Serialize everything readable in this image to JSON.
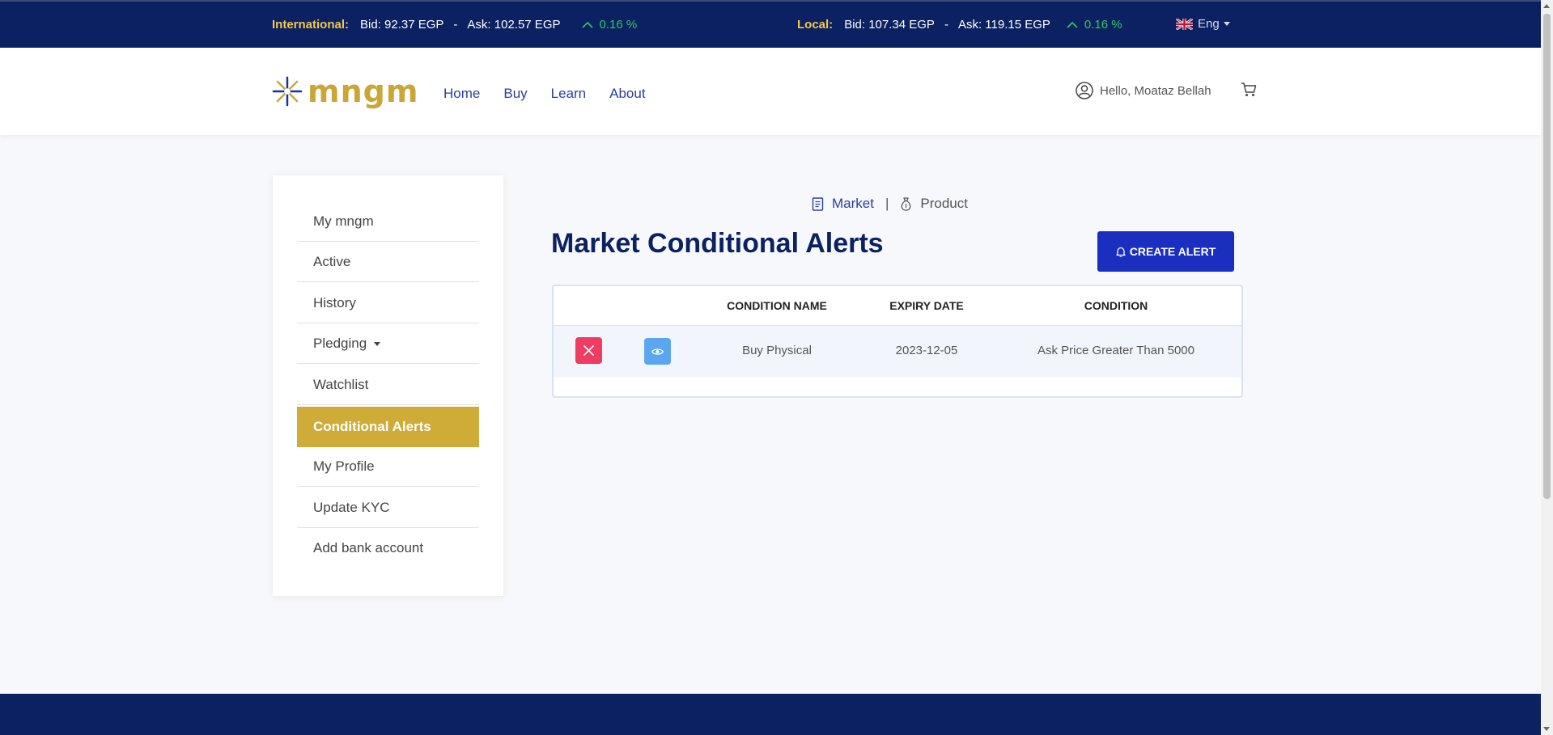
{
  "ticker": {
    "international": {
      "label": "International:",
      "bid": "Bid: 92.37 EGP",
      "sep": "-",
      "ask": "Ask: 102.57 EGP",
      "change": "0.16 %"
    },
    "local": {
      "label": "Local:",
      "bid": "Bid: 107.34 EGP",
      "sep": "-",
      "ask": "Ask: 119.15 EGP",
      "change": "0.16 %"
    },
    "language": "Eng"
  },
  "header": {
    "logo": "mngm",
    "nav": [
      "Home",
      "Buy",
      "Learn",
      "About"
    ],
    "greeting": "Hello, Moataz Bellah"
  },
  "sidebar": {
    "items": [
      {
        "label": "My mngm"
      },
      {
        "label": "Active"
      },
      {
        "label": "History"
      },
      {
        "label": "Pledging"
      },
      {
        "label": "Watchlist"
      },
      {
        "label": "Conditional Alerts"
      },
      {
        "label": "My Profile"
      },
      {
        "label": "Update KYC"
      },
      {
        "label": "Add bank account"
      }
    ],
    "active_index": 5
  },
  "main": {
    "toggle": {
      "market": "Market",
      "separator": "|",
      "product": "Product"
    },
    "title": "Market Conditional Alerts",
    "create_button": "CREATE ALERT",
    "table": {
      "headers": [
        "CONDITION NAME",
        "EXPIRY DATE",
        "CONDITION"
      ],
      "rows": [
        {
          "name": "Buy Physical",
          "expiry": "2023-12-05",
          "condition": "Ask Price Greater Than 5000"
        }
      ]
    }
  },
  "colors": {
    "navy": "#0b2161",
    "gold": "#cfab37",
    "primary_button": "#1a2fc0",
    "delete": "#ee3c62",
    "view": "#5aa7ef",
    "positive": "#2ecc5b"
  }
}
